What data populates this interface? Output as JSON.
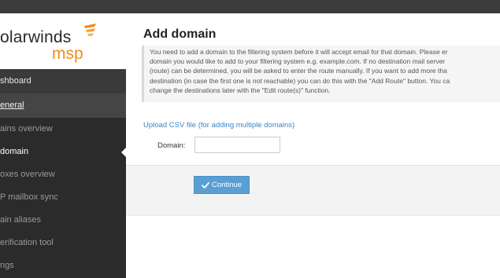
{
  "app": {
    "brand": "olarwinds",
    "brand_sub": "msp"
  },
  "sidebar": {
    "items": [
      {
        "label": "shboard"
      },
      {
        "label": "eneral"
      },
      {
        "label": "ains overview"
      },
      {
        "label": "domain"
      },
      {
        "label": "oxes overview"
      },
      {
        "label": "P mailbox sync"
      },
      {
        "label": "ain aliases"
      },
      {
        "label": "erification tool"
      },
      {
        "label": "ngs"
      }
    ]
  },
  "main": {
    "title": "Add domain",
    "intro_lines": [
      "You need to add a domain to the filtering system before it will accept email for that domain. Please er",
      "domain you would like to add to your filtering system e.g. example.com. If no destination mail server",
      "(route) can be determined, you will be asked to enter the route manually. If you want to add more tha",
      "destination (in case the first one is not reachable) you can do this with the \"Add Route\" button. You ca",
      "change the destinations later with the \"Edit route(s)\" function."
    ],
    "upload_link": "Upload CSV file (for adding multiple domains)",
    "domain_label": "Domain:",
    "domain_value": "",
    "domain_placeholder": "",
    "continue_label": "Continue"
  },
  "colors": {
    "accent": "#5a9fd4",
    "link": "#3b86c6",
    "brand_orange": "#f08a1c",
    "sidebar_bg": "#2b2b2b",
    "topbar_bg": "#3b3b3b"
  },
  "icons": {
    "logo": "solarwinds-flame-icon",
    "caret": "caret-left-icon",
    "continue": "checkmark-icon"
  }
}
